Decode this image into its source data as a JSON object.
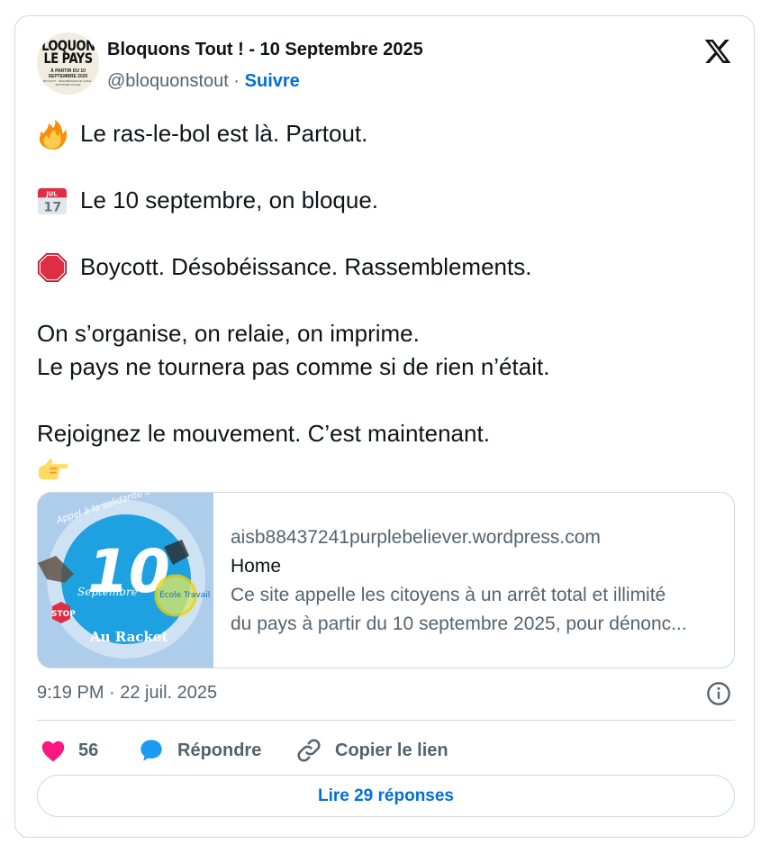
{
  "author": {
    "name": "Bloquons Tout ! - 10 Septembre 2025",
    "handle": "@bloquonstout",
    "separator": "·",
    "follow_label": "Suivre",
    "avatar": {
      "line1": "BLOQUONS",
      "line2": "LE PAYS",
      "line3": "À PARTIR DU 10 SEPTEMBRE 2025",
      "line4": "BOYCOTT · DÉSOBÉISSANCE CIVILE · ENTRAIDE LOCALE"
    }
  },
  "platform_icon": "x-logo-icon",
  "tweet": {
    "lines": [
      {
        "emoji": "fire-icon",
        "text": "Le ras-le-bol est là. Partout."
      },
      {
        "emoji": "",
        "text": ""
      },
      {
        "emoji": "calendar-icon",
        "text": "Le 10 septembre, on bloque."
      },
      {
        "emoji": "",
        "text": ""
      },
      {
        "emoji": "stop-sign-icon",
        "text": "Boycott. Désobéissance. Rassemblements."
      },
      {
        "emoji": "",
        "text": ""
      },
      {
        "emoji": "",
        "text": "On s’organise, on relaie, on imprime."
      },
      {
        "emoji": "",
        "text": "Le pays ne tournera pas comme si de rien n’était."
      },
      {
        "emoji": "",
        "text": ""
      },
      {
        "emoji": "",
        "text": "Rejoignez le mouvement. C’est maintenant."
      },
      {
        "emoji": "pointing-right-icon",
        "text": ""
      }
    ],
    "calendar_emoji": {
      "month": "JUL",
      "day": "17"
    }
  },
  "link_card": {
    "domain": "aisb88437241purplebeliever.wordpress.com",
    "title": "Home",
    "description_line1": "Ce site appelle les citoyens à un arrêt total et illimité",
    "description_line2": "du pays à partir du 10 septembre 2025, pour dénonc...",
    "thumbnail": {
      "arc_text": "Appel à la solidarité du peuple",
      "big_number": "10",
      "subtitle": "Septembre",
      "badge": "École Travail",
      "stop": "STOP",
      "footer": "Au Racket"
    }
  },
  "timestamp": "9:19 PM · 22 juil. 2025",
  "actions": {
    "likes_count": "56",
    "reply_label": "Répondre",
    "copy_link_label": "Copier le lien"
  },
  "read_replies_label": "Lire 29 réponses",
  "colors": {
    "accent": "#006fd6",
    "like": "#f91880",
    "reply": "#1d9bf0",
    "muted": "#536471",
    "border": "#cfd9de"
  }
}
